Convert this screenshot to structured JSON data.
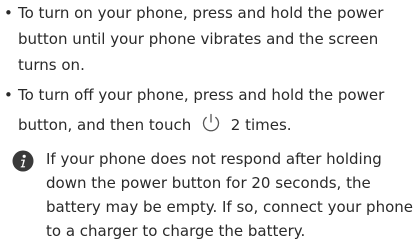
{
  "bullets": [
    {
      "marker": "•",
      "lines": [
        "To turn on your phone, press and hold the power",
        "button until your phone vibrates and the screen",
        "turns on."
      ]
    },
    {
      "marker": "•",
      "lines": [
        "To turn off your phone, press and hold the power"
      ],
      "line2_before": "button, and then touch",
      "line2_after": "2 times."
    }
  ],
  "icons": {
    "power": "power-icon",
    "note": "info-icon"
  },
  "note": {
    "lines": [
      "If your phone does not respond after holding",
      "down the power button for 20 seconds, the",
      "battery may be empty. If so, connect your phone",
      "to a charger to charge the battery."
    ]
  }
}
